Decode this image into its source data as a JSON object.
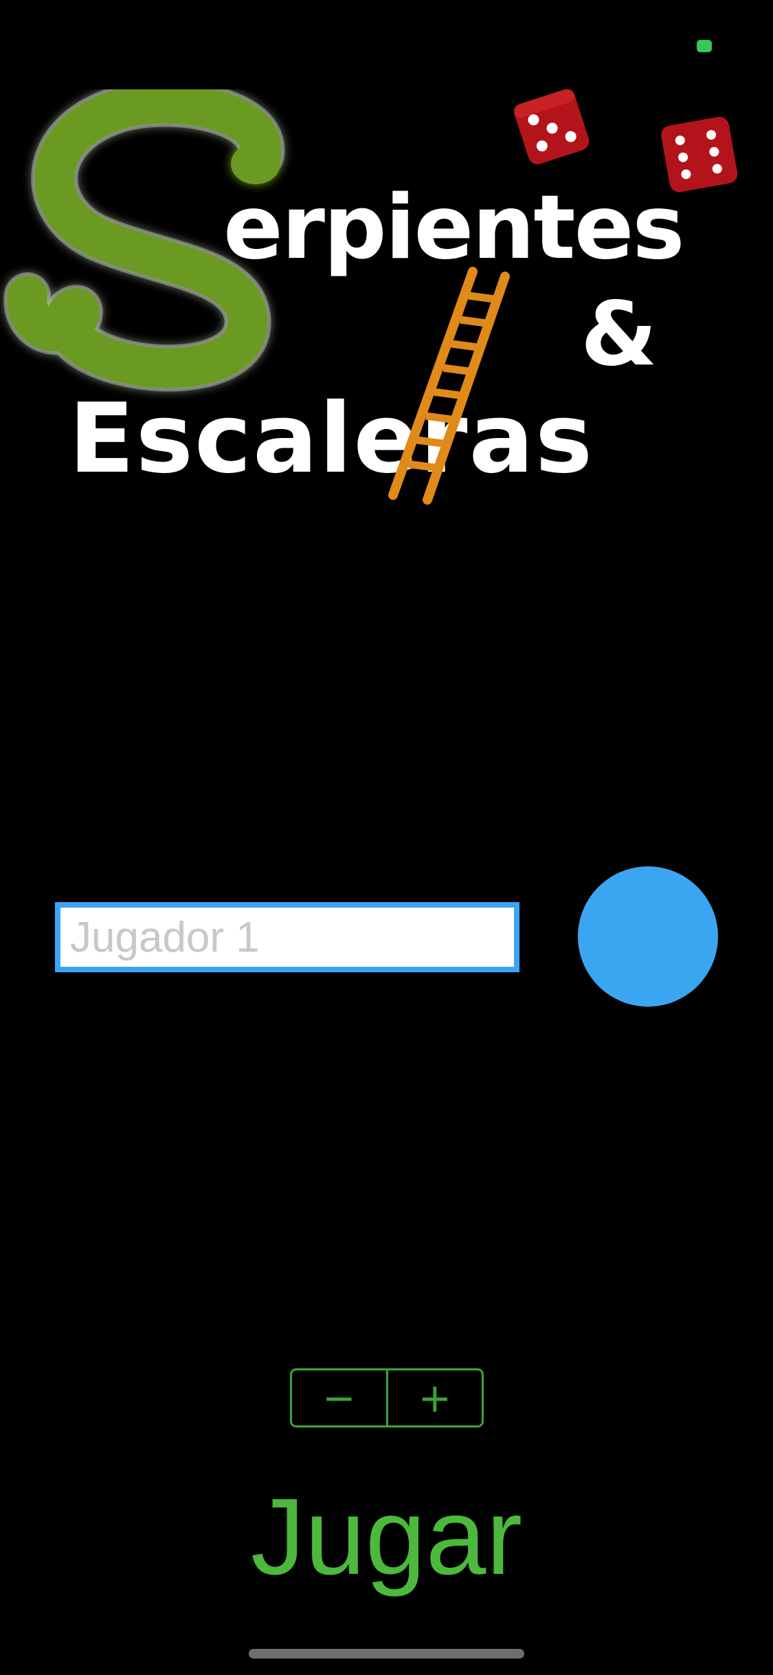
{
  "status_bar": {
    "indicator_color": "#34c759"
  },
  "logo": {
    "line1": "erpientes",
    "ampersand": "&",
    "line2": "Escaleras",
    "big_letter": "S"
  },
  "player": {
    "name_placeholder": "Jugador 1",
    "name_value": "",
    "color": "#3aa6f2"
  },
  "stepper": {
    "decrement_label": "−",
    "increment_label": "+"
  },
  "play": {
    "label": "Jugar",
    "color": "#4cb83c"
  },
  "theme": {
    "background": "#000000",
    "accent": "#3aa635",
    "snake_green": "#6a9a22"
  }
}
